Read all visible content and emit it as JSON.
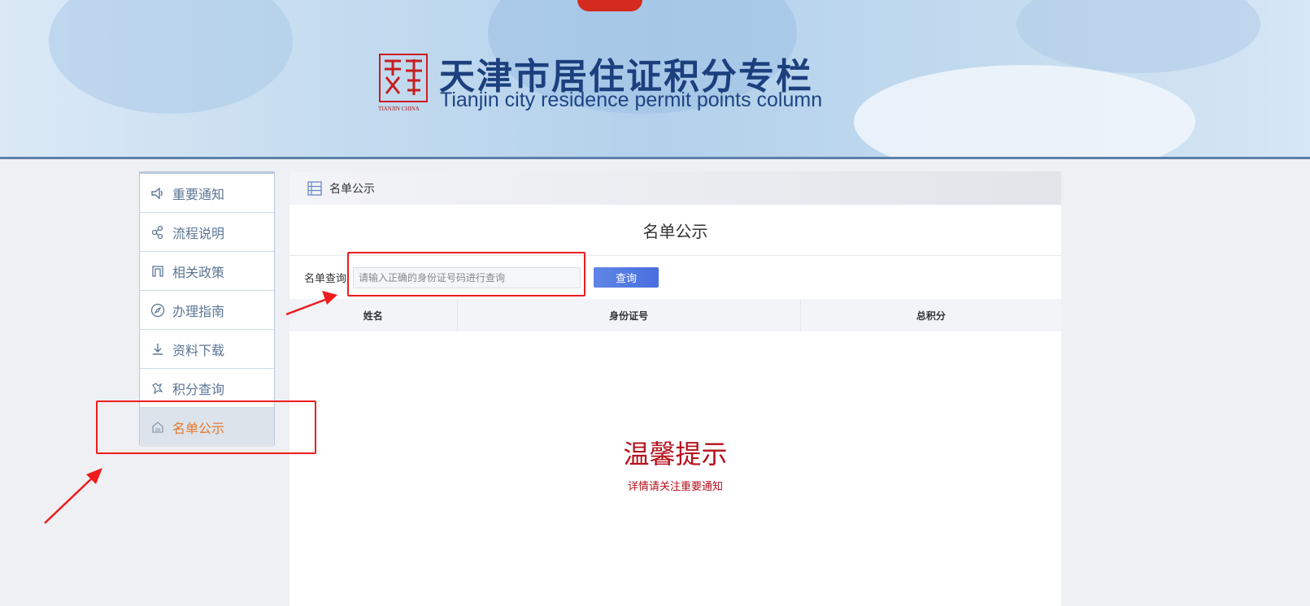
{
  "banner": {
    "title_cn": "天津市居住证积分专栏",
    "title_en": "Tianjin city residence permit points column",
    "seal_caption": "TIANJIN CHINA"
  },
  "sidebar": {
    "items": [
      {
        "label": "重要通知",
        "icon": "speaker-icon"
      },
      {
        "label": "流程说明",
        "icon": "flow-icon"
      },
      {
        "label": "相关政策",
        "icon": "policy-icon"
      },
      {
        "label": "办理指南",
        "icon": "compass-icon"
      },
      {
        "label": "资料下载",
        "icon": "download-icon"
      },
      {
        "label": "积分查询",
        "icon": "points-search-icon"
      },
      {
        "label": "名单公示",
        "icon": "list-icon",
        "active": true
      }
    ]
  },
  "main": {
    "breadcrumb": "名单公示",
    "title": "名单公示",
    "query_label": "名单查询",
    "query_placeholder": "请输入正确的身份证号码进行查询",
    "query_button": "查询",
    "table_headers": [
      "姓名",
      "身份证号",
      "总积分"
    ],
    "notice_title": "温馨提示",
    "notice_sub": "详情请关注重要通知"
  },
  "colors": {
    "accent": "#e5762a",
    "notice": "#b3121e",
    "button": "#4a6fe0",
    "annotation": "#ee1c1c"
  }
}
